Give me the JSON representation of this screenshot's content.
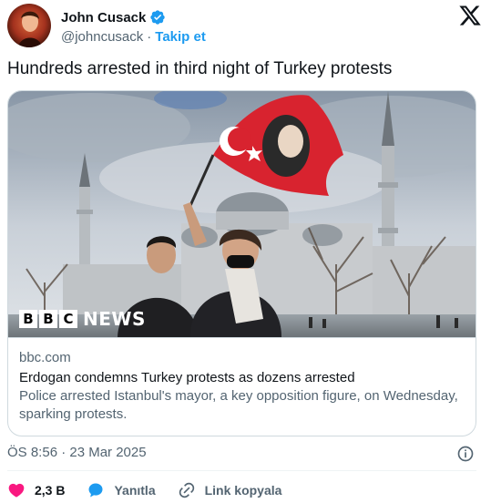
{
  "header": {
    "display_name": "John Cusack",
    "handle": "@johncusack",
    "separator": "·",
    "follow_label": "Takip et"
  },
  "tweet": {
    "text": "Hundreds arrested in third night of Turkey protests"
  },
  "card": {
    "brand_letters": [
      "B",
      "B",
      "C"
    ],
    "brand_suffix": "NEWS",
    "domain": "bbc.com",
    "title": "Erdogan condemns Turkey protests as dozens arrested",
    "description": "Police arrested Istanbul's mayor, a key opposition figure, on Wednesday, sparking protests."
  },
  "meta": {
    "timestamp": "ÖS 8:56 · 23 Mar 2025"
  },
  "actions": {
    "like_count": "2,3 B",
    "reply_label": "Yanıtla",
    "copy_link_label": "Link kopyala"
  },
  "colors": {
    "accent": "#1d9bf0",
    "like": "#f91880",
    "text_secondary": "#536471"
  },
  "icons": [
    "verified-badge-icon",
    "x-logo-icon",
    "info-icon",
    "heart-icon",
    "reply-bubble-icon",
    "link-icon"
  ]
}
